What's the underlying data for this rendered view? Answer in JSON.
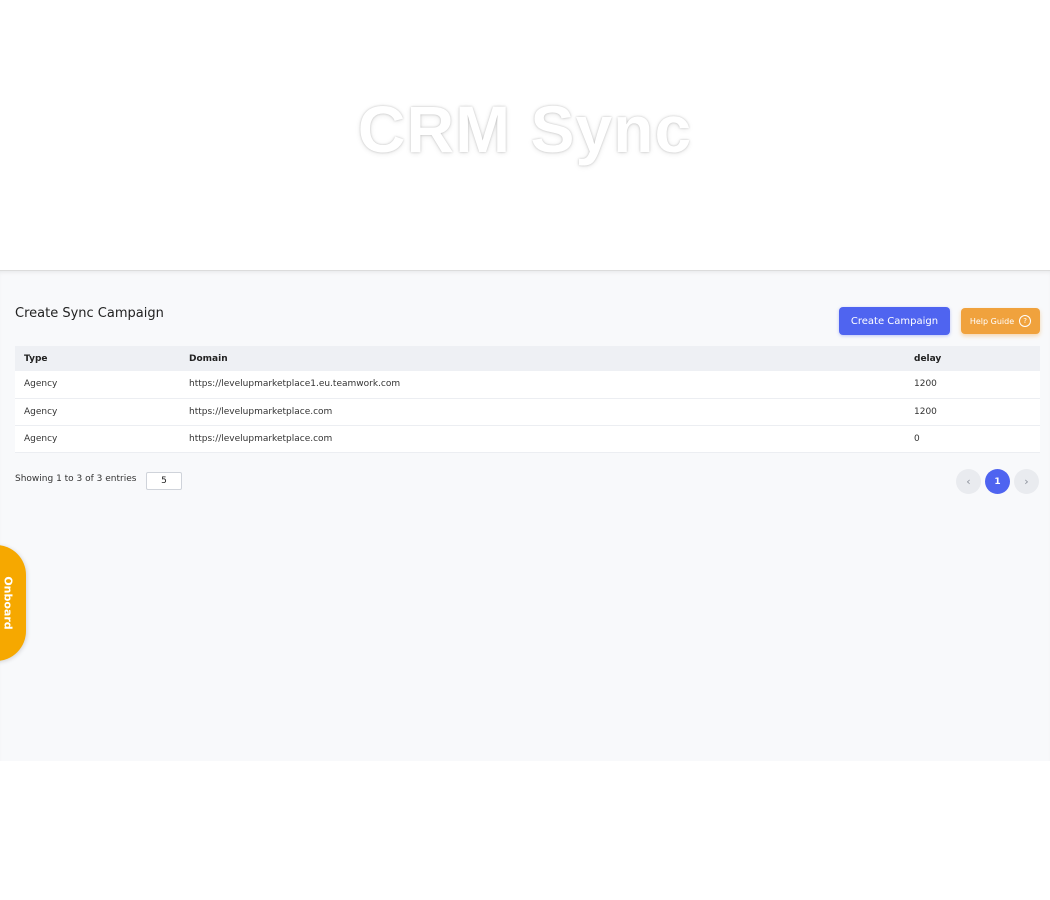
{
  "header": {
    "title": "CRM Sync"
  },
  "main": {
    "title": "Create Sync Campaign",
    "buttons": {
      "create": "Create Campaign",
      "help": "Help Guide",
      "help_icon_glyph": "?"
    },
    "table": {
      "columns": [
        "Type",
        "Domain",
        "delay"
      ],
      "rows": [
        [
          "Agency",
          "https://levelupmarketplace1.eu.teamwork.com",
          "1200"
        ],
        [
          "Agency",
          "https://levelupmarketplace.com",
          "1200"
        ],
        [
          "Agency",
          "https://levelupmarketplace.com",
          "0"
        ]
      ]
    },
    "footer": {
      "showing": "Showing 1 to 3 of 3 entries",
      "page_size": "5"
    },
    "pagination": {
      "prev": "‹",
      "current": "1",
      "next": "›"
    }
  },
  "onboard": {
    "label": "Onboard"
  },
  "colors": {
    "primary": "#4f64f0",
    "help": "#f0a23d",
    "onboard": "#f6a800",
    "background": "#f8f9fb"
  },
  "icons": [
    "help-circle-icon",
    "chevron-left-icon",
    "chevron-right-icon"
  ]
}
